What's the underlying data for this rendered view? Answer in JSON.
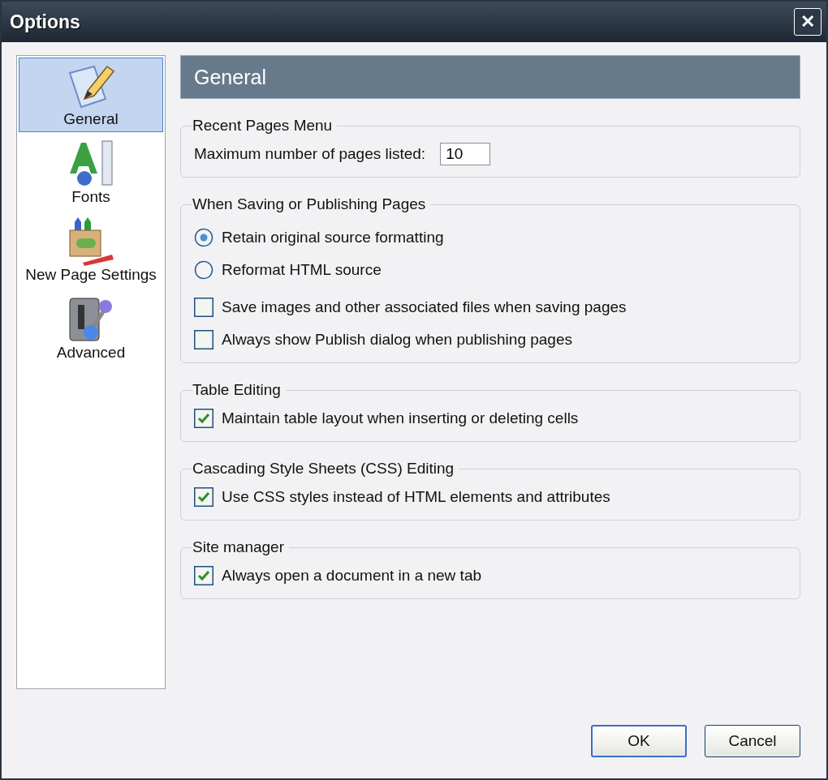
{
  "window": {
    "title": "Options",
    "close": "✕"
  },
  "sidebar": {
    "items": [
      {
        "label": "General",
        "kind": "pencil",
        "selected": true
      },
      {
        "label": "Fonts",
        "kind": "fonts",
        "selected": false
      },
      {
        "label": "New Page Settings",
        "kind": "crayons",
        "selected": false
      },
      {
        "label": "Advanced",
        "kind": "advanced",
        "selected": false
      }
    ]
  },
  "header": "General",
  "groups": [
    {
      "title": "Recent Pages Menu",
      "items": [
        {
          "kind": "number",
          "label": "Maximum number of pages listed:",
          "value": "10"
        }
      ]
    },
    {
      "title": "When Saving or Publishing Pages",
      "items": [
        {
          "kind": "radio",
          "label": "Retain original source formatting",
          "selected": true
        },
        {
          "kind": "radio",
          "label": "Reformat HTML source",
          "selected": false
        },
        {
          "kind": "checkbox",
          "label": "Save images and other associated files when saving pages",
          "checked": false
        },
        {
          "kind": "checkbox",
          "label": "Always show Publish dialog when publishing pages",
          "checked": false
        }
      ]
    },
    {
      "title": "Table Editing",
      "items": [
        {
          "kind": "checkbox",
          "label": "Maintain table layout when inserting or deleting cells",
          "checked": true
        }
      ]
    },
    {
      "title": "Cascading Style Sheets (CSS) Editing",
      "items": [
        {
          "kind": "checkbox",
          "label": "Use CSS styles instead of HTML elements and attributes",
          "checked": true
        }
      ]
    },
    {
      "title": "Site manager",
      "items": [
        {
          "kind": "checkbox",
          "label": "Always open a document in a new tab",
          "checked": true
        }
      ]
    }
  ],
  "buttons": [
    {
      "label": "OK",
      "default": true
    },
    {
      "label": "Cancel",
      "default": false
    }
  ]
}
